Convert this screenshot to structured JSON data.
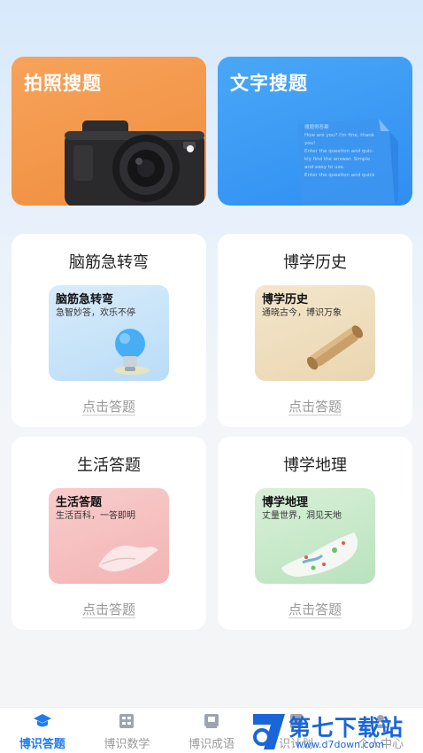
{
  "top_cards": {
    "photo_search": {
      "title": "拍照搜题"
    },
    "text_search": {
      "title": "文字搜题",
      "doc_lines": [
        "搜题得答案",
        "How are you? I'm fine, thank",
        "you!",
        "Enter the question and quic-",
        "kly find the answer. Simple",
        "and easy to use.",
        "Enter the question and quick"
      ]
    }
  },
  "quiz_cards": [
    {
      "title": "脑筋急转弯",
      "thumb_title": "脑筋急转弯",
      "thumb_desc": "急智妙答，欢乐不停",
      "answer_label": "点击答题"
    },
    {
      "title": "博学历史",
      "thumb_title": "博学历史",
      "thumb_desc": "通晓古今，博识万象",
      "answer_label": "点击答题"
    },
    {
      "title": "生活答题",
      "thumb_title": "生活答题",
      "thumb_desc": "生活百科，一答即明",
      "answer_label": "点击答题"
    },
    {
      "title": "博学地理",
      "thumb_title": "博学地理",
      "thumb_desc": "丈量世界，洞见天地",
      "answer_label": "点击答题"
    }
  ],
  "tabbar": {
    "tabs": [
      {
        "label": "博识答题",
        "icon": "graduation-cap-icon",
        "active": true
      },
      {
        "label": "博识数学",
        "icon": "calculator-icon",
        "active": false
      },
      {
        "label": "博识成语",
        "icon": "idiom-book-icon",
        "active": false
      },
      {
        "label": "识计划",
        "icon": "plan-icon",
        "active": false
      },
      {
        "label": "个人中心",
        "icon": "user-icon",
        "active": false
      }
    ]
  },
  "watermark": {
    "title": "第七下载站",
    "url": "www.d7down.com"
  },
  "colors": {
    "accent": "#1f7bf0",
    "photo_card": "#f29545",
    "text_card": "#3b9af4"
  }
}
